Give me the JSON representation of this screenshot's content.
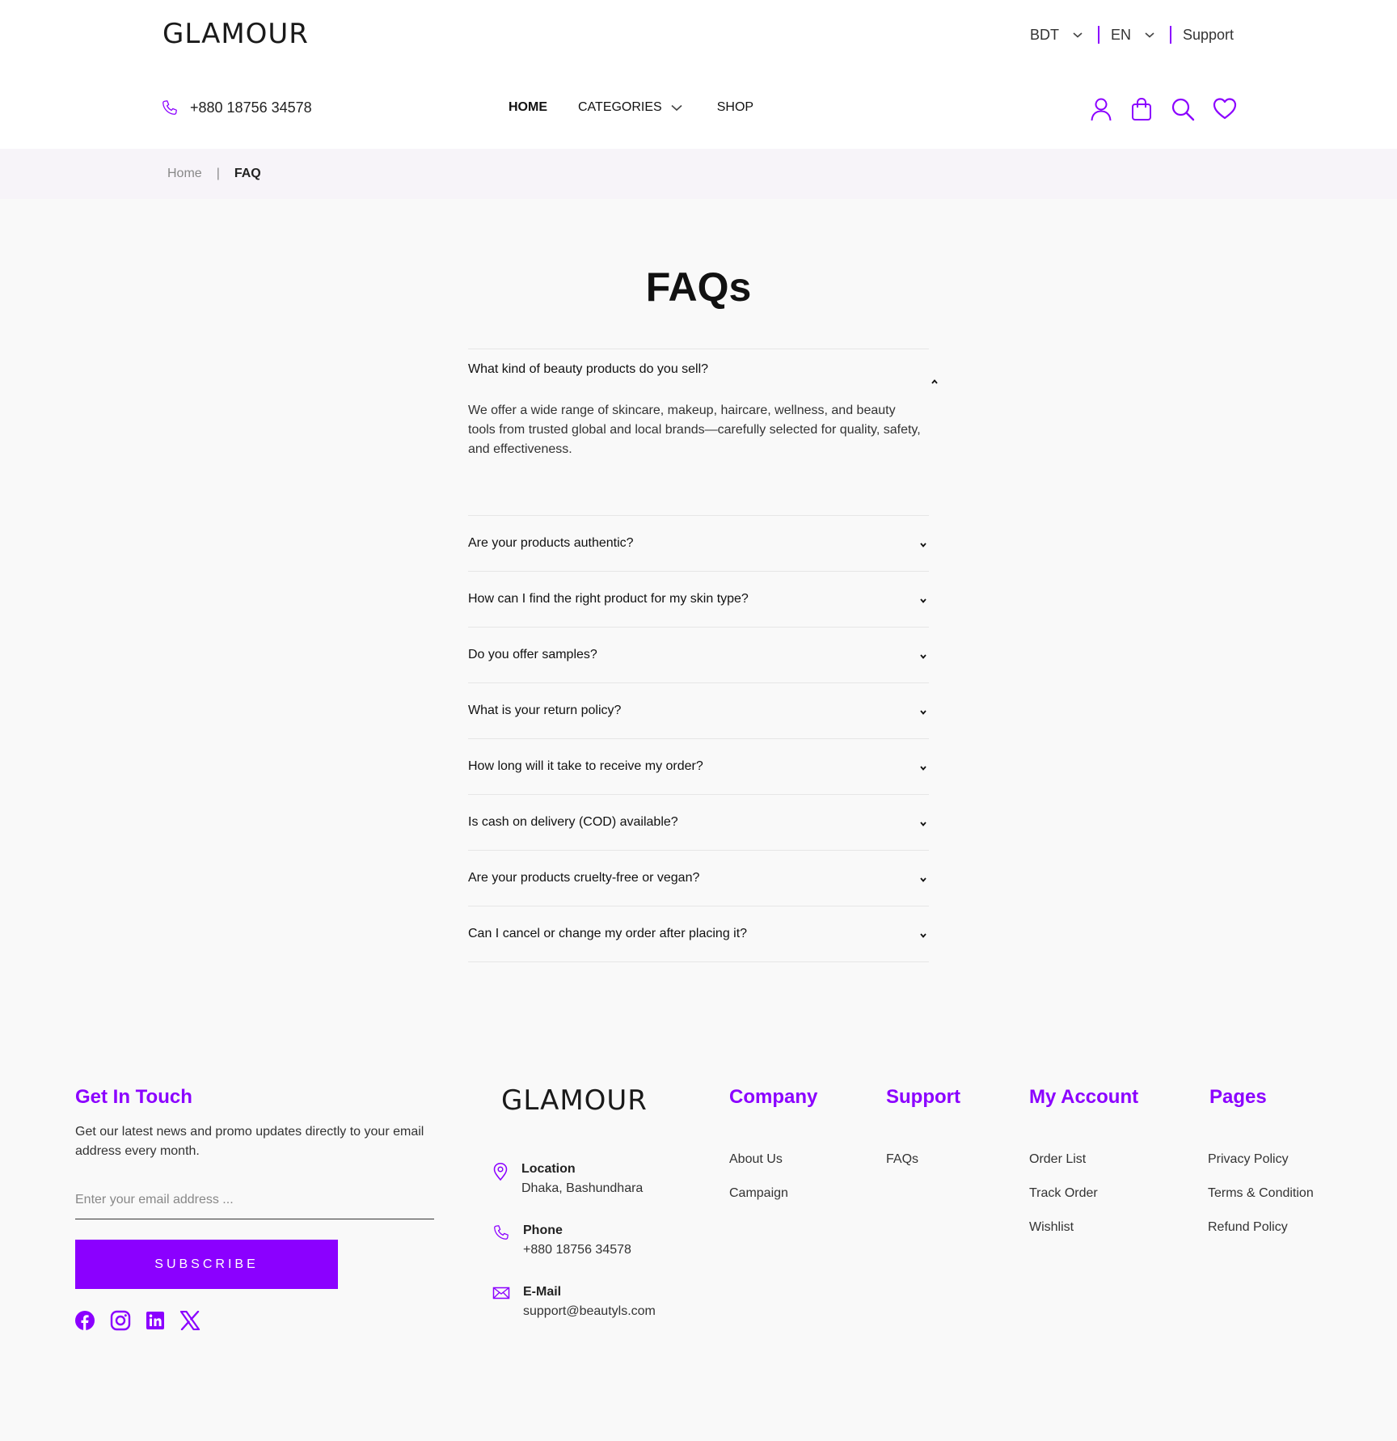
{
  "header": {
    "logo": "GLAMOUR",
    "currency": "BDT",
    "language": "EN",
    "support": "Support",
    "phone": "+880 18756 34578",
    "nav": {
      "home": "HOME",
      "categories": "CATEGORIES",
      "shop": "SHOP"
    },
    "icons": [
      "user-icon",
      "bag-icon",
      "search-icon",
      "heart-icon"
    ]
  },
  "breadcrumb": {
    "home": "Home",
    "separator": "|",
    "current": "FAQ"
  },
  "faq": {
    "title": "FAQs",
    "items": [
      {
        "question": "What kind of beauty products do you sell?",
        "answer": "We offer a wide range of skincare, makeup, haircare, wellness, and beauty tools from trusted global and local brands—carefully selected for quality, safety, and effectiveness.",
        "expanded": true
      },
      {
        "question": "Are your products authentic?",
        "expanded": false
      },
      {
        "question": "How can I find the right product for my skin type?",
        "expanded": false
      },
      {
        "question": "Do you offer samples?",
        "expanded": false
      },
      {
        "question": "What is your return policy?",
        "expanded": false
      },
      {
        "question": "How long will it take to receive my order?",
        "expanded": false
      },
      {
        "question": "Is cash on delivery (COD) available?",
        "expanded": false
      },
      {
        "question": "Are your products cruelty-free or vegan?",
        "expanded": false
      },
      {
        "question": "Can I cancel or change my order after placing it?",
        "expanded": false
      }
    ]
  },
  "footer": {
    "get_in_touch": {
      "heading": "Get In Touch",
      "text": "Get our latest news and promo updates directly to your email address every month.",
      "email_placeholder": "Enter your email address ...",
      "subscribe": "SUBSCRIBE",
      "socials": [
        "facebook-icon",
        "instagram-icon",
        "linkedin-icon",
        "x-icon"
      ]
    },
    "logo": "GLAMOUR",
    "contact": {
      "location_label": "Location",
      "location": "Dhaka, Bashundhara",
      "phone_label": "Phone",
      "phone": "+880 18756 34578",
      "email_label": "E-Mail",
      "email": "support@beautyls.com"
    },
    "company": {
      "heading": "Company",
      "links": [
        "About Us",
        "Campaign"
      ]
    },
    "support": {
      "heading": "Support",
      "links": [
        "FAQs"
      ]
    },
    "account": {
      "heading": "My Account",
      "links": [
        "Order List",
        "Track Order",
        "Wishlist"
      ]
    },
    "pages": {
      "heading": "Pages",
      "links": [
        "Privacy Policy",
        "Terms & Condition",
        "Refund Policy"
      ]
    }
  },
  "colors": {
    "accent": "#8b00ff",
    "breadcrumb_bg": "#f7f4f9",
    "page_bg": "#f9f9f9"
  }
}
